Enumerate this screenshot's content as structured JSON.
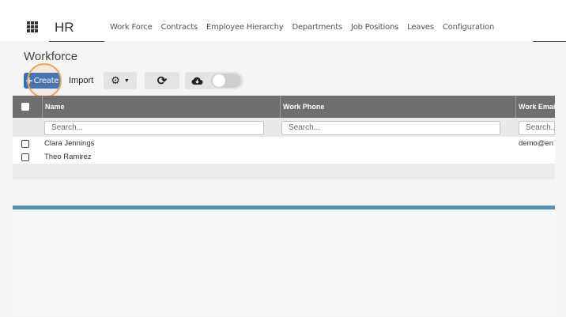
{
  "app": {
    "title": "HR",
    "menu_icon": "apps-grid-icon"
  },
  "nav": {
    "items": [
      "Work Force",
      "Contracts",
      "Employee Hierarchy",
      "Departments",
      "Job Positions",
      "Leaves",
      "Configuration"
    ]
  },
  "page": {
    "title": "Workforce"
  },
  "toolbar": {
    "create_label": "Create",
    "import_label": "Import",
    "gear_icon": "gear-icon",
    "refresh_icon": "refresh-icon",
    "cloud_icon": "cloud-download-icon"
  },
  "table": {
    "columns": [
      "Name",
      "Work Phone",
      "Work Email"
    ],
    "filter_placeholder": "Search...",
    "rows": [
      {
        "name": "Clara Jennings",
        "phone": "",
        "email": "demo@en"
      },
      {
        "name": "Theo Ramirez",
        "phone": "",
        "email": ""
      }
    ]
  },
  "colors": {
    "primary": "#2f6fc4",
    "header": "#6f6f6f",
    "highlight": "#f0a34a",
    "accent_bar": "#5b8db1"
  }
}
